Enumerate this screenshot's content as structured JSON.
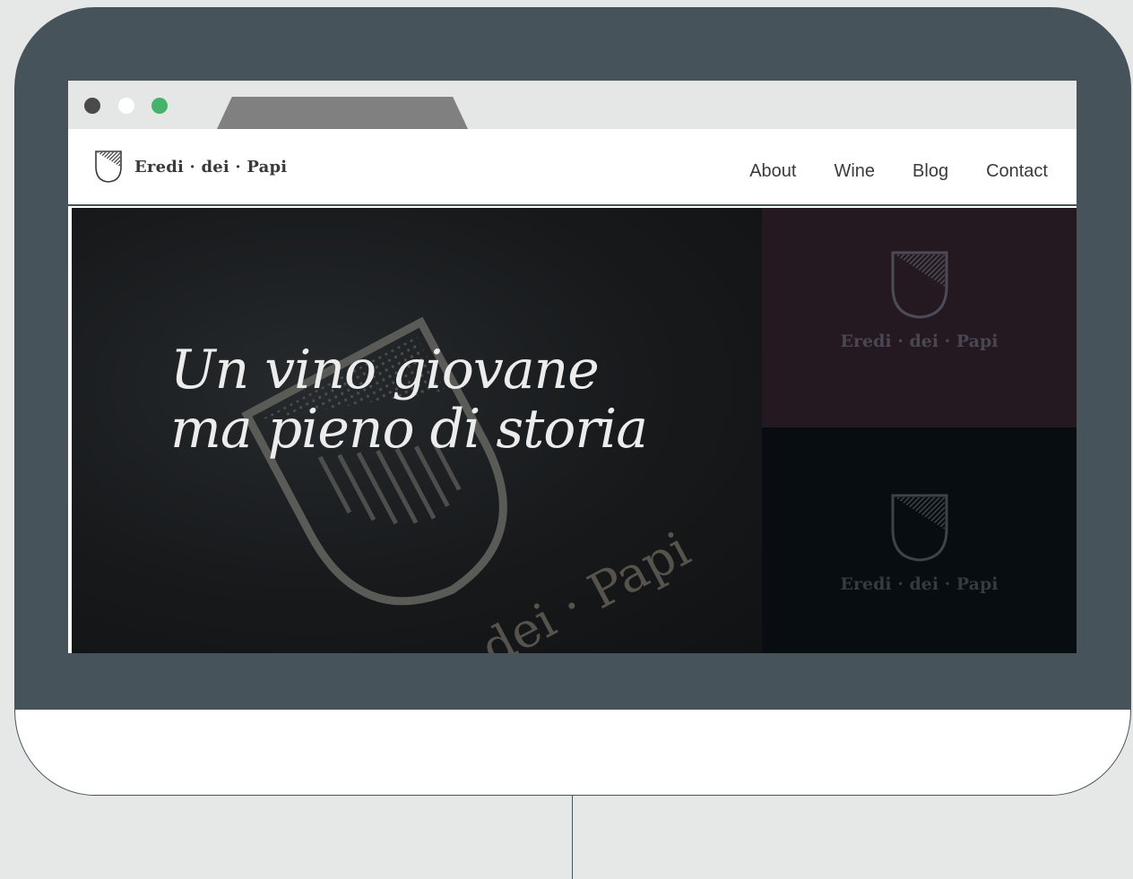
{
  "browser": {
    "window_controls": [
      "close",
      "minimize",
      "maximize"
    ]
  },
  "site": {
    "brand": "Eredi · dei · Papi",
    "nav": [
      {
        "label": "About"
      },
      {
        "label": "Wine"
      },
      {
        "label": "Blog"
      },
      {
        "label": "Contact"
      }
    ]
  },
  "hero": {
    "title_line1": "Un vino giovane",
    "title_line2": "ma pieno di storia",
    "emboss_text": "dei · Papi"
  },
  "panels": [
    {
      "brand": "Eredi · dei · Papi",
      "background": "#241921"
    },
    {
      "brand": "Eredi · dei · Papi",
      "background": "#070d10"
    }
  ],
  "colors": {
    "bezel": "#46535b",
    "page_bg": "#e6e8e7",
    "maximize_dot": "#45b36b"
  }
}
